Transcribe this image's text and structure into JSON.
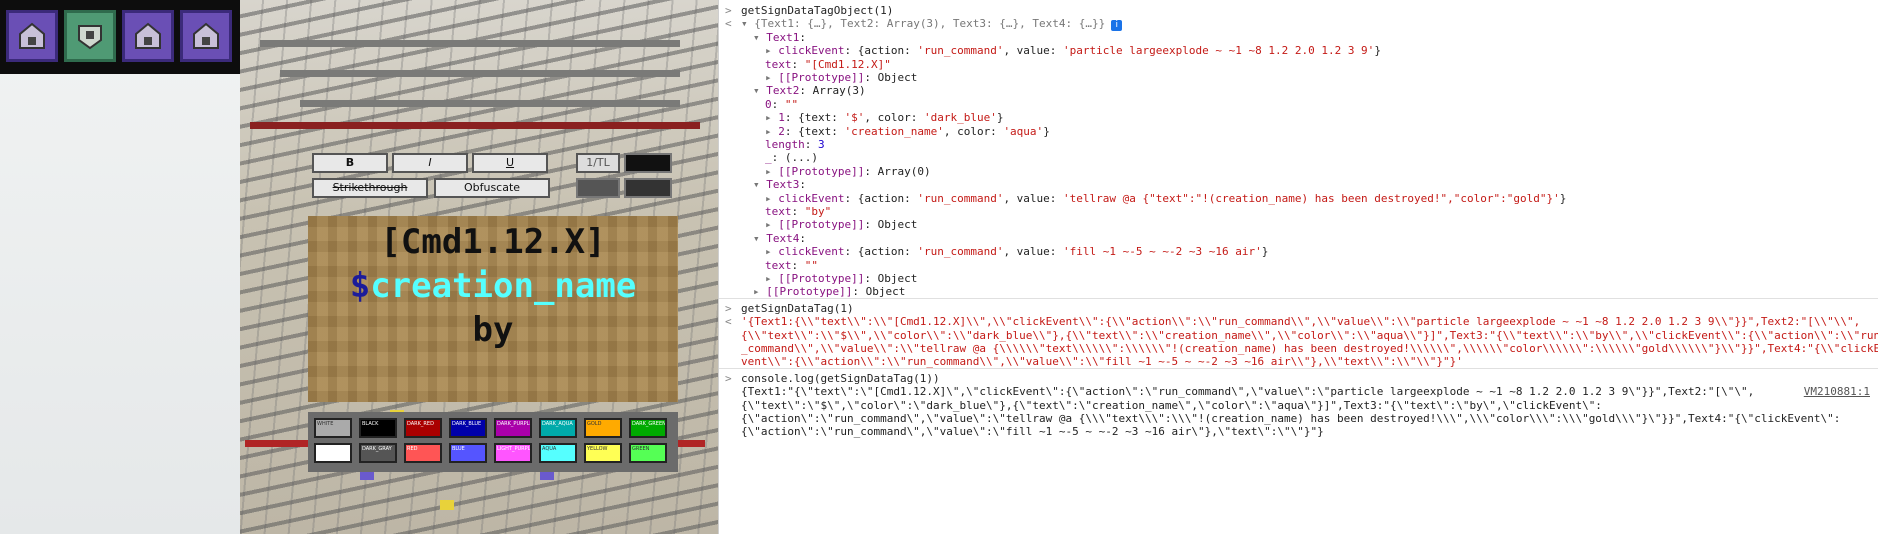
{
  "game": {
    "format_buttons": [
      "B",
      "I",
      "U",
      "Strikethrough",
      "Obfuscate",
      "1/TL"
    ],
    "sign_lines": [
      {
        "text": "[Cmd1.12.X]",
        "color": "#111111"
      },
      {
        "prefix": "$",
        "prefix_color": "#1c1c9a",
        "text": "creation_name",
        "color": "#55ffff"
      },
      {
        "text": "by",
        "color": "#111111"
      },
      {
        "text": "",
        "color": "#111111"
      }
    ],
    "color_swatches": [
      {
        "label": "WHITE",
        "color": "#aaaaaa"
      },
      {
        "label": "BLACK",
        "color": "#000000"
      },
      {
        "label": "DARK_RED",
        "color": "#aa0000"
      },
      {
        "label": "DARK_BLUE",
        "color": "#0000aa"
      },
      {
        "label": "DARK_PURPLE",
        "color": "#aa00aa"
      },
      {
        "label": "DARK_AQUA",
        "color": "#00aaaa"
      },
      {
        "label": "GOLD",
        "color": "#ffaa00"
      },
      {
        "label": "DARK_GREEN",
        "color": "#00aa00"
      },
      {
        "label": "",
        "color": "#ffffff"
      },
      {
        "label": "DARK_GRAY",
        "color": "#555555"
      },
      {
        "label": "RED",
        "color": "#ff5555"
      },
      {
        "label": "BLUE",
        "color": "#5555ff"
      },
      {
        "label": "LIGHT_PURPLE",
        "color": "#ff55ff"
      },
      {
        "label": "AQUA",
        "color": "#55ffff"
      },
      {
        "label": "YELLOW",
        "color": "#ffff55"
      },
      {
        "label": "GREEN",
        "color": "#55ff55"
      }
    ],
    "hotbar_icons": [
      "command-block-icon",
      "chain-command-block-icon",
      "command-block-icon",
      "command-block-icon"
    ]
  },
  "console": {
    "entries": [
      {
        "gutter": ">",
        "parts": [
          {
            "t": "getSignDataTagObject(1)",
            "c": ""
          }
        ]
      },
      {
        "gutter": "<",
        "parts": [
          {
            "t": "▾ ",
            "c": "g"
          },
          {
            "t": "{Text1: {…}, Text2: Array(3), Text3: {…}, Text4: {…}}",
            "c": "g"
          }
        ]
      },
      {
        "gutter": "",
        "indent": 1,
        "parts": [
          {
            "t": "▾ ",
            "c": "g"
          },
          {
            "t": "Text1",
            "c": "k"
          },
          {
            "t": ":",
            "c": ""
          }
        ]
      },
      {
        "gutter": "",
        "indent": 2,
        "parts": [
          {
            "t": "▸ ",
            "c": "g"
          },
          {
            "t": "clickEvent",
            "c": "k"
          },
          {
            "t": ": {action: ",
            "c": ""
          },
          {
            "t": "'run_command'",
            "c": "s"
          },
          {
            "t": ", value: ",
            "c": ""
          },
          {
            "t": "'particle largeexplode ~ ~1 ~8 1.2 2.0 1.2 3 9'",
            "c": "s"
          },
          {
            "t": "}",
            "c": ""
          }
        ]
      },
      {
        "gutter": "",
        "indent": 2,
        "parts": [
          {
            "t": "text",
            "c": "k"
          },
          {
            "t": ": ",
            "c": ""
          },
          {
            "t": "\"[Cmd1.12.X]\"",
            "c": "s"
          }
        ]
      },
      {
        "gutter": "",
        "indent": 2,
        "parts": [
          {
            "t": "▸ ",
            "c": "g"
          },
          {
            "t": "[[Prototype]]",
            "c": "k"
          },
          {
            "t": ": Object",
            "c": ""
          }
        ]
      },
      {
        "gutter": "",
        "indent": 1,
        "parts": [
          {
            "t": "▾ ",
            "c": "g"
          },
          {
            "t": "Text2",
            "c": "k"
          },
          {
            "t": ": Array(3)",
            "c": ""
          }
        ]
      },
      {
        "gutter": "",
        "indent": 2,
        "parts": [
          {
            "t": "0",
            "c": "k"
          },
          {
            "t": ": ",
            "c": ""
          },
          {
            "t": "\"\"",
            "c": "s"
          }
        ]
      },
      {
        "gutter": "",
        "indent": 2,
        "parts": [
          {
            "t": "▸ ",
            "c": "g"
          },
          {
            "t": "1",
            "c": "k"
          },
          {
            "t": ": {text: ",
            "c": ""
          },
          {
            "t": "'$'",
            "c": "s"
          },
          {
            "t": ", color: ",
            "c": ""
          },
          {
            "t": "'dark_blue'",
            "c": "s"
          },
          {
            "t": "}",
            "c": ""
          }
        ]
      },
      {
        "gutter": "",
        "indent": 2,
        "parts": [
          {
            "t": "▸ ",
            "c": "g"
          },
          {
            "t": "2",
            "c": "k"
          },
          {
            "t": ": {text: ",
            "c": ""
          },
          {
            "t": "'creation_name'",
            "c": "s"
          },
          {
            "t": ", color: ",
            "c": ""
          },
          {
            "t": "'aqua'",
            "c": "s"
          },
          {
            "t": "}",
            "c": ""
          }
        ]
      },
      {
        "gutter": "",
        "indent": 2,
        "parts": [
          {
            "t": "length",
            "c": "k"
          },
          {
            "t": ": ",
            "c": ""
          },
          {
            "t": "3",
            "c": "n"
          }
        ]
      },
      {
        "gutter": "",
        "indent": 2,
        "parts": [
          {
            "t": "_",
            "c": "k"
          },
          {
            "t": ": (...)",
            "c": ""
          }
        ]
      },
      {
        "gutter": "",
        "indent": 2,
        "parts": [
          {
            "t": "▸ ",
            "c": "g"
          },
          {
            "t": "[[Prototype]]",
            "c": "k"
          },
          {
            "t": ": Array(0)",
            "c": ""
          }
        ]
      },
      {
        "gutter": "",
        "indent": 1,
        "parts": [
          {
            "t": "▾ ",
            "c": "g"
          },
          {
            "t": "Text3",
            "c": "k"
          },
          {
            "t": ":",
            "c": ""
          }
        ]
      },
      {
        "gutter": "",
        "indent": 2,
        "parts": [
          {
            "t": "▸ ",
            "c": "g"
          },
          {
            "t": "clickEvent",
            "c": "k"
          },
          {
            "t": ": {action: ",
            "c": ""
          },
          {
            "t": "'run_command'",
            "c": "s"
          },
          {
            "t": ", value: ",
            "c": ""
          },
          {
            "t": "'tellraw @a {\"text\":\"!(creation_name) has been destroyed!\",\"color\":\"gold\"}'",
            "c": "s"
          },
          {
            "t": "}",
            "c": ""
          }
        ]
      },
      {
        "gutter": "",
        "indent": 2,
        "parts": [
          {
            "t": "text",
            "c": "k"
          },
          {
            "t": ": ",
            "c": ""
          },
          {
            "t": "\"by\"",
            "c": "s"
          }
        ]
      },
      {
        "gutter": "",
        "indent": 2,
        "parts": [
          {
            "t": "▸ ",
            "c": "g"
          },
          {
            "t": "[[Prototype]]",
            "c": "k"
          },
          {
            "t": ": Object",
            "c": ""
          }
        ]
      },
      {
        "gutter": "",
        "indent": 1,
        "parts": [
          {
            "t": "▾ ",
            "c": "g"
          },
          {
            "t": "Text4",
            "c": "k"
          },
          {
            "t": ":",
            "c": ""
          }
        ]
      },
      {
        "gutter": "",
        "indent": 2,
        "parts": [
          {
            "t": "▸ ",
            "c": "g"
          },
          {
            "t": "clickEvent",
            "c": "k"
          },
          {
            "t": ": {action: ",
            "c": ""
          },
          {
            "t": "'run_command'",
            "c": "s"
          },
          {
            "t": ", value: ",
            "c": ""
          },
          {
            "t": "'fill ~1 ~-5 ~ ~-2 ~3 ~16 air'",
            "c": "s"
          },
          {
            "t": "}",
            "c": ""
          }
        ]
      },
      {
        "gutter": "",
        "indent": 2,
        "parts": [
          {
            "t": "text",
            "c": "k"
          },
          {
            "t": ": ",
            "c": ""
          },
          {
            "t": "\"\"",
            "c": "s"
          }
        ]
      },
      {
        "gutter": "",
        "indent": 2,
        "parts": [
          {
            "t": "▸ ",
            "c": "g"
          },
          {
            "t": "[[Prototype]]",
            "c": "k"
          },
          {
            "t": ": Object",
            "c": ""
          }
        ]
      },
      {
        "gutter": "",
        "indent": 1,
        "parts": [
          {
            "t": "▸ ",
            "c": "g"
          },
          {
            "t": "[[Prototype]]",
            "c": "k"
          },
          {
            "t": ": Object",
            "c": ""
          }
        ]
      },
      {
        "gutter": ">",
        "sep": true,
        "parts": [
          {
            "t": "getSignDataTag(1)",
            "c": ""
          }
        ]
      },
      {
        "gutter": "<",
        "parts": [
          {
            "t": "'{Text1:{\\\\\"text\\\\\":\\\\\"[Cmd1.12.X]\\\\\",\\\\\"clickEvent\\\\\":{\\\\\"action\\\\\":\\\\\"run_command\\\\\",\\\\\"value\\\\\":\\\\\"particle largeexplode ~ ~1 ~8 1.2 2.0 1.2 3 9\\\\\"}}\",Text2:\"[\\\\\"\\\\\",",
            "c": "s"
          }
        ]
      },
      {
        "gutter": "",
        "parts": [
          {
            "t": "{\\\\\"text\\\\\":\\\\\"$\\\\\",\\\\\"color\\\\\":\\\\\"dark_blue\\\\\"},{\\\\\"text\\\\\":\\\\\"creation_name\\\\\",\\\\\"color\\\\\":\\\\\"aqua\\\\\"}]\",Text3:\"{\\\\\"text\\\\\":\\\\\"by\\\\\",\\\\\"clickEvent\\\\\":{\\\\\"action\\\\\":\\\\\"run",
            "c": "s"
          }
        ]
      },
      {
        "gutter": "",
        "parts": [
          {
            "t": "_command\\\\\",\\\\\"value\\\\\":\\\\\"tellraw @a {\\\\\\\\\\\\\"text\\\\\\\\\\\\\":\\\\\\\\\\\\\"!(creation_name) has been destroyed!\\\\\\\\\\\\\",\\\\\\\\\\\\\"color\\\\\\\\\\\\\":\\\\\\\\\\\\\"gold\\\\\\\\\\\\\"}\\\\\"}}\",Text4:\"{\\\\\"clickE",
            "c": "s"
          }
        ]
      },
      {
        "gutter": "",
        "parts": [
          {
            "t": "vent\\\\\":{\\\\\"action\\\\\":\\\\\"run_command\\\\\",\\\\\"value\\\\\":\\\\\"fill ~1 ~-5 ~ ~-2 ~3 ~16 air\\\\\"},\\\\\"text\\\\\":\\\\\"\\\\\"}\"}'",
            "c": "s"
          }
        ]
      },
      {
        "gutter": ">",
        "sep": true,
        "parts": [
          {
            "t": "console.log(getSignDataTag(1))",
            "c": ""
          }
        ]
      },
      {
        "gutter": "",
        "link": "VM210881:1",
        "parts": [
          {
            "t": "{Text1:\"{\\\"text\\\":\\\"[Cmd1.12.X]\\\",\\\"clickEvent\\\":{\\\"action\\\":\\\"run_command\\\",\\\"value\\\":\\\"particle largeexplode ~ ~1 ~8 1.2 2.0 1.2 3 9\\\"}}\",Text2:\"[\\\"\\\",",
            "c": ""
          }
        ]
      },
      {
        "gutter": "",
        "parts": [
          {
            "t": "{\\\"text\\\":\\\"$\\\",\\\"color\\\":\\\"dark_blue\\\"},{\\\"text\\\":\\\"creation_name\\\",\\\"color\\\":\\\"aqua\\\"}]\",Text3:\"{\\\"text\\\":\\\"by\\\",\\\"clickEvent\\\":",
            "c": ""
          }
        ]
      },
      {
        "gutter": "",
        "parts": [
          {
            "t": "{\\\"action\\\":\\\"run_command\\\",\\\"value\\\":\\\"tellraw @a {\\\\\\\"text\\\\\\\":\\\\\\\"!(creation_name) has been destroyed!\\\\\\\",\\\\\\\"color\\\\\\\":\\\\\\\"gold\\\\\\\"}\\\"}}\",Text4:\"{\\\"clickEvent\\\":",
            "c": ""
          }
        ]
      },
      {
        "gutter": "",
        "parts": [
          {
            "t": "{\\\"action\\\":\\\"run_command\\\",\\\"value\\\":\\\"fill ~1 ~-5 ~ ~-2 ~3 ~16 air\\\"},\\\"text\\\":\\\"\\\"}\"}",
            "c": ""
          }
        ]
      }
    ]
  }
}
